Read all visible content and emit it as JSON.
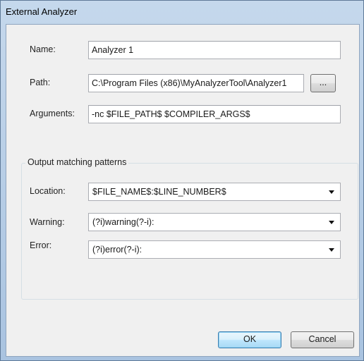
{
  "window": {
    "title": "External Analyzer"
  },
  "fields": {
    "name": {
      "label": "Name:",
      "value": "Analyzer 1"
    },
    "path": {
      "label": "Path:",
      "value": "C:\\Program Files (x86)\\MyAnalyzerTool\\Analyzer1",
      "browse_label": "..."
    },
    "arguments": {
      "label": "Arguments:",
      "value": "-nc $FILE_PATH$ $COMPILER_ARGS$"
    }
  },
  "patterns": {
    "group_title": "Output matching patterns",
    "location": {
      "label": "Location:",
      "value": "$FILE_NAME$:$LINE_NUMBER$"
    },
    "warning": {
      "label": "Warning:",
      "value": "(?i)warning(?-i):"
    },
    "error": {
      "label": "Error:",
      "value": "(?i)error(?-i):"
    }
  },
  "buttons": {
    "ok": "OK",
    "cancel": "Cancel"
  }
}
